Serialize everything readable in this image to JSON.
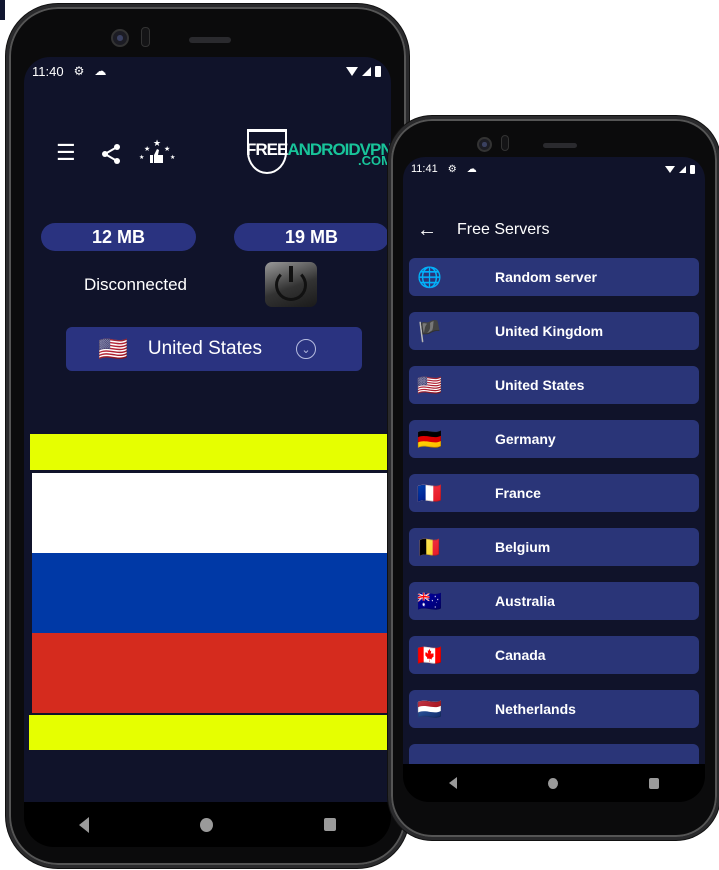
{
  "phone_main": {
    "status_bar": {
      "time": "11:40",
      "icons": [
        "gear-icon",
        "cloud-icon"
      ],
      "right_icons": [
        "wifi-icon",
        "cell-signal-icon",
        "battery-icon"
      ]
    },
    "toolbar": {
      "menu_icon": "☰",
      "share_icon": "<",
      "rate_icon": "★👍"
    },
    "logo": {
      "text_white": "FREE",
      "text_green": "ANDROIDVPN",
      "domain": ".COM"
    },
    "traffic": {
      "download": "12 MB",
      "upload": "19 MB"
    },
    "connection_status": "Disconnected",
    "selected_country": {
      "flag": "🇺🇸",
      "name": "United States"
    },
    "banner_colors": {
      "yellow": "#e6ff00",
      "white": "#ffffff",
      "blue": "#0039a6",
      "red": "#d52b1e"
    },
    "nav": [
      "back",
      "home",
      "recents"
    ]
  },
  "phone_servers": {
    "status_bar": {
      "time": "11:41"
    },
    "header": {
      "back_icon": "←",
      "title": "Free Servers"
    },
    "servers": [
      {
        "flag": "🌐",
        "name": "Random server"
      },
      {
        "flag": "🏴",
        "name": "United Kingdom"
      },
      {
        "flag": "🇺🇸",
        "name": "United States"
      },
      {
        "flag": "🇩🇪",
        "name": "Germany"
      },
      {
        "flag": "🇫🇷",
        "name": "France"
      },
      {
        "flag": "🇧🇪",
        "name": "Belgium"
      },
      {
        "flag": "🇦🇺",
        "name": "Australia"
      },
      {
        "flag": "🇨🇦",
        "name": "Canada"
      },
      {
        "flag": "🇳🇱",
        "name": "Netherlands"
      }
    ]
  },
  "colors": {
    "screen_bg": "#10132a",
    "accent": "#2a3380",
    "logo_green": "#18c49a"
  }
}
